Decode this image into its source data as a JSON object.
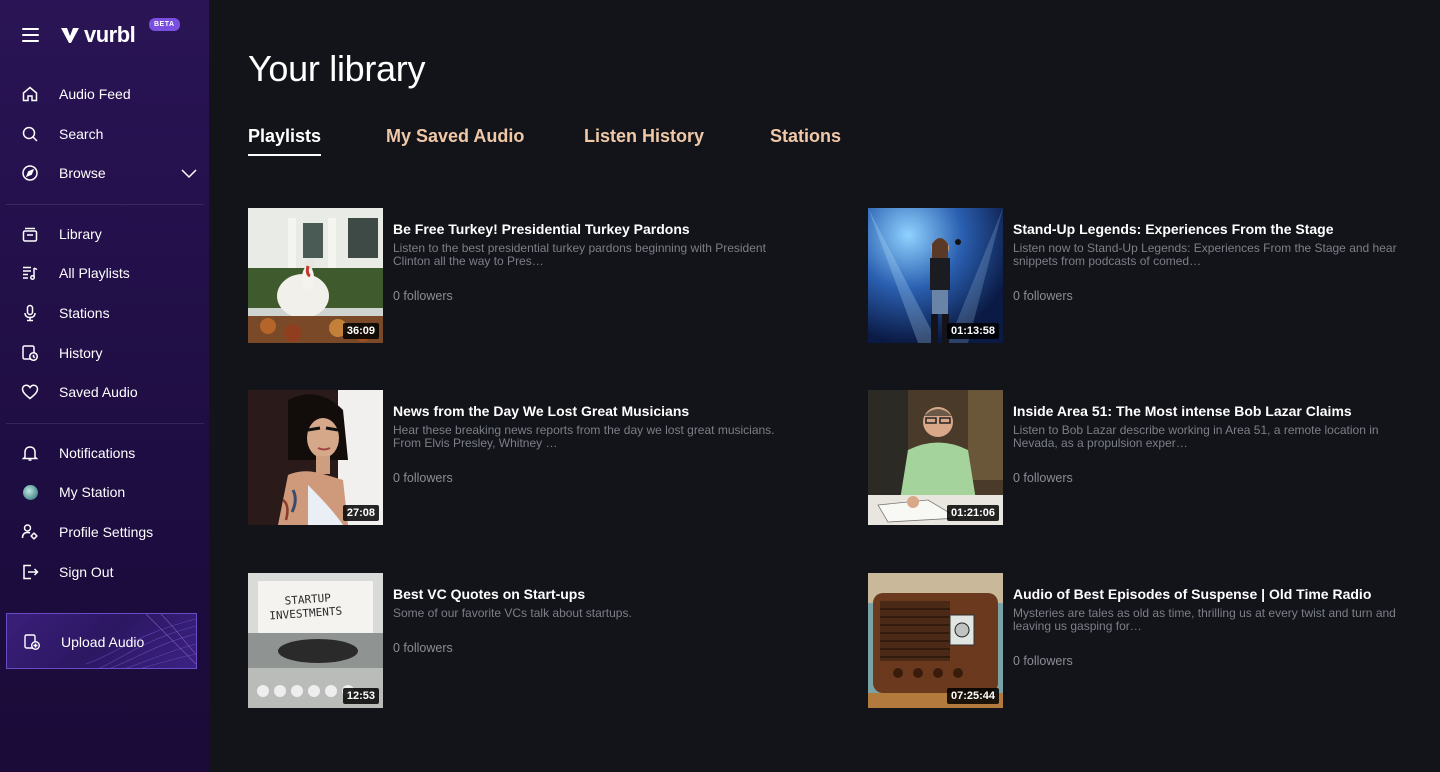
{
  "app": {
    "name": "vurbl",
    "badge": "BETA"
  },
  "sidebar": {
    "items": [
      {
        "label": "Audio Feed",
        "icon": "home-icon"
      },
      {
        "label": "Search",
        "icon": "search-icon"
      },
      {
        "label": "Browse",
        "icon": "compass-icon"
      },
      {
        "label": "Library",
        "icon": "library-icon"
      },
      {
        "label": "All Playlists",
        "icon": "playlist-icon"
      },
      {
        "label": "Stations",
        "icon": "microphone-icon"
      },
      {
        "label": "History",
        "icon": "history-icon"
      },
      {
        "label": "Saved Audio",
        "icon": "heart-icon"
      },
      {
        "label": "Notifications",
        "icon": "bell-icon"
      },
      {
        "label": "My Station",
        "icon": "station-avatar-icon"
      },
      {
        "label": "Profile Settings",
        "icon": "user-settings-icon"
      },
      {
        "label": "Sign Out",
        "icon": "sign-out-icon"
      }
    ],
    "upload_label": "Upload Audio"
  },
  "main": {
    "title": "Your library",
    "tabs": [
      {
        "label": "Playlists",
        "active": true
      },
      {
        "label": "My Saved Audio",
        "active": false
      },
      {
        "label": "Listen History",
        "active": false
      },
      {
        "label": "Stations",
        "active": false
      }
    ],
    "playlists": [
      {
        "title": "Be Free Turkey! Presidential Turkey Pardons",
        "description": "Listen to the best presidential turkey pardons beginning with President Clinton all the way to Pres…",
        "followers": "0 followers",
        "duration": "36:09"
      },
      {
        "title": "Stand-Up Legends: Experiences From the Stage",
        "description": "Listen now to Stand-Up Legends: Experiences From the Stage and hear snippets from podcasts of comed…",
        "followers": "0 followers",
        "duration": "01:13:58"
      },
      {
        "title": "News from the Day We Lost Great Musicians",
        "description": "Hear these breaking news reports from the day we lost great musicians. From Elvis Presley, Whitney …",
        "followers": "0 followers",
        "duration": "27:08"
      },
      {
        "title": "Inside Area 51: The Most intense Bob Lazar Claims",
        "description": "Listen to Bob Lazar describe working in Area 51, a remote location in Nevada, as a propulsion exper…",
        "followers": "0 followers",
        "duration": "01:21:06"
      },
      {
        "title": "Best VC Quotes on Start-ups",
        "description": "Some of our favorite VCs talk about startups.",
        "followers": "0 followers",
        "duration": "12:53",
        "thumb_text": [
          "STARTUP",
          "INVESTMENTS"
        ]
      },
      {
        "title": "Audio of Best Episodes of Suspense | Old Time Radio",
        "description": "Mysteries are tales as old as time, thrilling us at every twist and turn and leaving us gasping for…",
        "followers": "0 followers",
        "duration": "07:25:44"
      }
    ]
  },
  "colors": {
    "sidebar": "#2a1455",
    "background": "#13141a",
    "tab_inactive": "#f0c8a8",
    "accent": "#7a4fe0"
  }
}
